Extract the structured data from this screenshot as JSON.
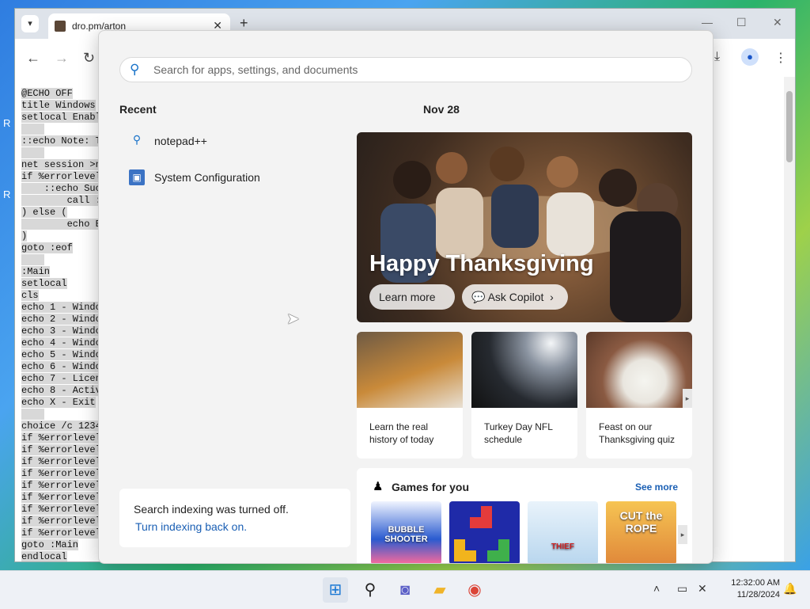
{
  "browser": {
    "tab_title": "dro.pm/arton",
    "new_tab": "+",
    "tab_close": "✕",
    "controls": {
      "minimize": "—",
      "maximize": "☐",
      "close": "✕"
    },
    "nav": {
      "back": "←",
      "forward": "→",
      "reload": "↻"
    },
    "right_tools": {
      "download": "⤓",
      "menu": "⋮"
    }
  },
  "code_lines": [
    "@ECHO OFF",
    "title Windows",
    "setlocal Enabl",
    "",
    "::echo Note: T",
    "",
    "net session >n",
    "if %errorlevel",
    "    ::echo Suc",
    "        call :",
    ") else (",
    "        echo E",
    ")",
    "goto :eof",
    "",
    ":Main",
    "setlocal",
    "cls",
    "echo 1 - Windo",
    "echo 2 - Windo",
    "echo 3 - Windo",
    "echo 4 - Windo",
    "echo 5 - Windo",
    "echo 6 - Windo",
    "echo 7 - Licen",
    "echo 8 - Activ",
    "echo X - Exit",
    "",
    "choice /c 1234",
    "if %errorlevel",
    "if %errorlevel",
    "if %errorlevel",
    "if %errorlevel",
    "if %errorlevel",
    "if %errorlevel",
    "if %errorlevel",
    "if %errorlevel",
    "if %errorlevel",
    "goto :Main",
    "endlocal"
  ],
  "start_menu": {
    "search": {
      "placeholder": "Search for apps, settings, and documents"
    },
    "recent_heading": "Recent",
    "recent_items": [
      {
        "label": "notepad++",
        "icon": "search-icon"
      },
      {
        "label": "System Configuration",
        "icon": "system-config-icon"
      }
    ],
    "date_heading": "Nov 28",
    "hero": {
      "title": "Happy Thanksgiving",
      "learn_more": "Learn more",
      "ask_copilot": "Ask Copilot"
    },
    "cards": [
      {
        "text": "Learn the real history of today"
      },
      {
        "text": "Turkey Day NFL schedule"
      },
      {
        "text": "Feast on our Thanksgiving quiz"
      }
    ],
    "games": {
      "heading": "Games for you",
      "see_more": "See more",
      "tiles": [
        {
          "label": "BUBBLE SHOOTER"
        },
        {
          "label": ""
        },
        {
          "label": "THIEF"
        },
        {
          "label": "CUT the ROPE"
        }
      ]
    },
    "notice": {
      "text": "Search indexing was turned off.",
      "link": "Turn indexing back on."
    }
  },
  "taskbar": {
    "time": "12:32:00 AM",
    "date": "11/28/2024"
  }
}
